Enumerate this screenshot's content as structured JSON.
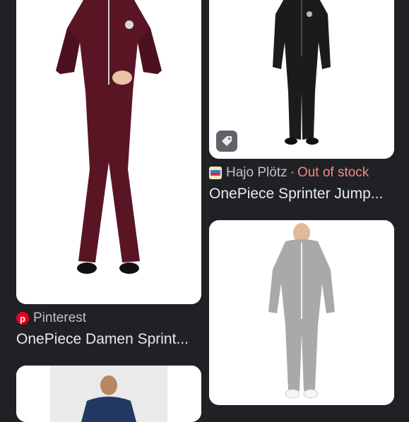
{
  "results": [
    {
      "source": "Pinterest",
      "title": "OnePiece Damen Sprint...",
      "image_alt": "burgundy jumpsuit",
      "source_icon": "pinterest-icon"
    },
    {
      "source": "Hajo Plötz",
      "status": "Out of stock",
      "separator": "·",
      "title": "OnePiece Sprinter Jump...",
      "image_alt": "black jumpsuit",
      "source_icon": "store-favicon",
      "badge_icon": "price-tag-icon"
    },
    {
      "image_alt": "grey jumpsuit"
    },
    {
      "image_alt": "navy hoodie"
    }
  ],
  "colors": {
    "background": "#202124",
    "out_of_stock": "#f28b82",
    "pinterest": "#e60023"
  }
}
